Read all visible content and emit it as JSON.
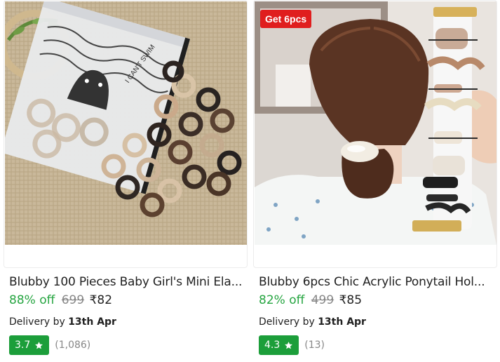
{
  "products": [
    {
      "title": "Blubby 100 Pieces Baby Girl's Mini Ela...",
      "discount": "88% off",
      "mrp": "699",
      "price": "₹82",
      "delivery_prefix": "Delivery by",
      "delivery_date": "13th Apr",
      "rating": "3.7",
      "rating_count": "(1,086)",
      "image_icon": "hair-ties-pack-image",
      "pouch_text": "I CAN'T SWIM"
    },
    {
      "title": "Blubby 6pcs Chic Acrylic Ponytail Hol...",
      "discount": "82% off",
      "mrp": "499",
      "price": "₹85",
      "delivery_prefix": "Delivery by",
      "delivery_date": "13th Apr",
      "rating": "4.3",
      "rating_count": "(13)",
      "badge": "Get 6pcs",
      "image_icon": "ponytail-holder-image"
    }
  ],
  "colors": {
    "discount_green": "#26a541",
    "rating_green": "#1c9e3a",
    "badge_red": "#e01e1e",
    "muted_gray": "#878787"
  },
  "icons": {
    "rating": "star-icon"
  }
}
